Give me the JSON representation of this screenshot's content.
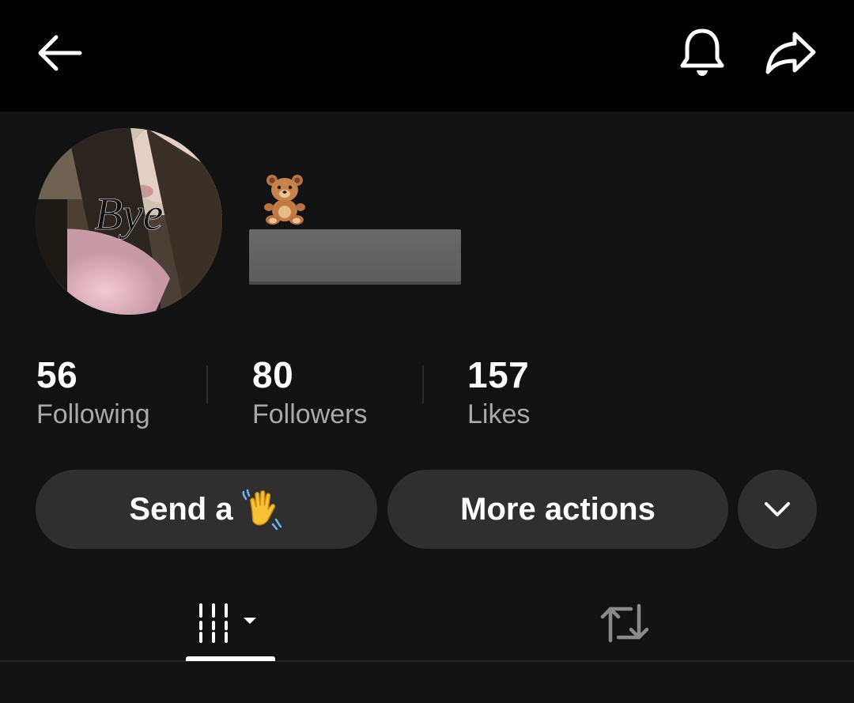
{
  "topbar": {
    "back_icon": "arrow-left-icon",
    "notification_icon": "bell-icon",
    "share_icon": "share-arrow-icon"
  },
  "profile": {
    "avatar_caption": "Bye",
    "badge_emoji": "teddy-bear-emoji",
    "username_redacted": true
  },
  "stats": [
    {
      "value": "56",
      "label": "Following"
    },
    {
      "value": "80",
      "label": "Followers"
    },
    {
      "value": "157",
      "label": "Likes"
    }
  ],
  "actions": {
    "send_label": "Send a",
    "send_emoji": "waving-hand-emoji",
    "more_label": "More actions",
    "expand_icon": "chevron-down-icon"
  },
  "tabs": [
    {
      "name": "videos",
      "icon": "grid-videos-icon",
      "active": true
    },
    {
      "name": "reposts",
      "icon": "repost-icon",
      "active": false
    }
  ],
  "colors": {
    "background": "#121212",
    "topbar": "#000000",
    "button": "#2f2f2f",
    "secondary_text": "#a9a9a9",
    "inactive_icon": "#8a8a8a"
  }
}
